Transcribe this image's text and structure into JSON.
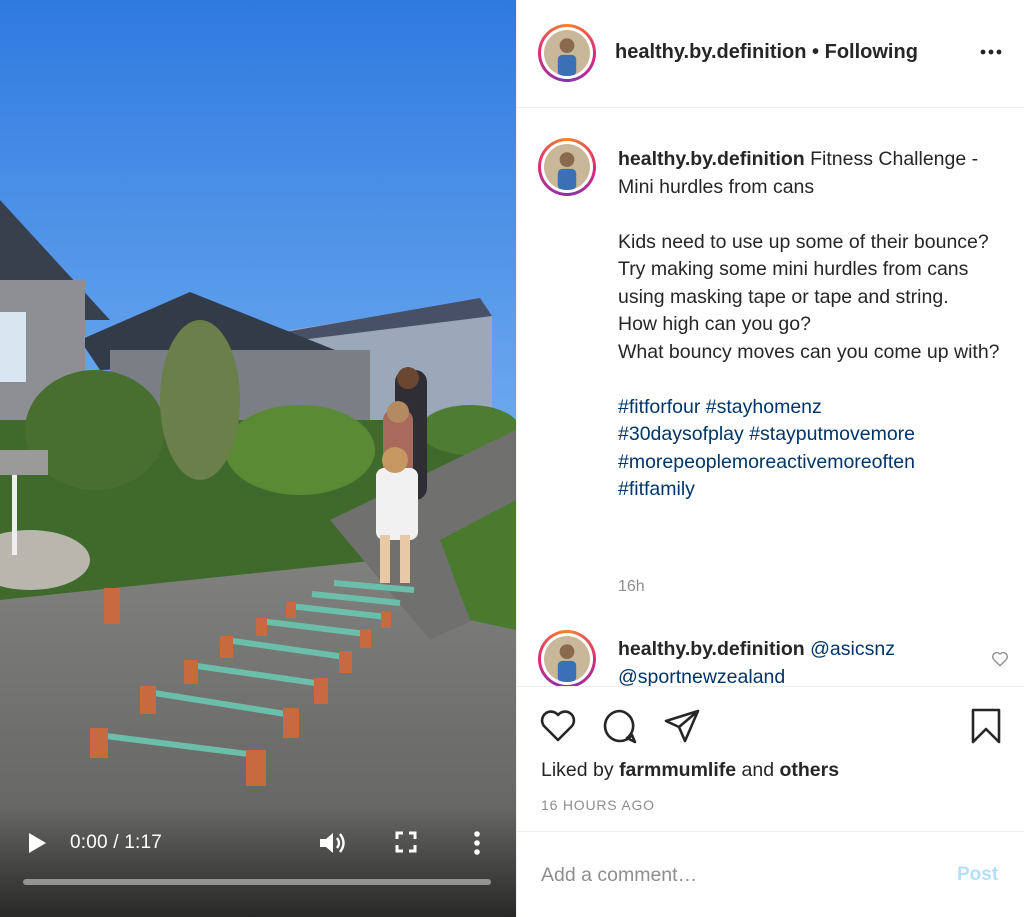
{
  "video": {
    "time_display": "0:00 / 1:17",
    "progress_fraction": 0.0,
    "icons": {
      "play": "play-icon",
      "volume": "volume-icon",
      "fullscreen": "fullscreen-icon",
      "more": "more-vertical-icon"
    }
  },
  "header": {
    "username": "healthy.by.definition",
    "separator": " • ",
    "follow_status": "Following",
    "more_icon": "more-horizontal-icon"
  },
  "caption": {
    "username": "healthy.by.definition",
    "title": " Fitness Challenge - Mini hurdles from cans",
    "body_lines": [
      "Kids need to use up some of their bounce? Try making some mini hurdles from cans using masking tape or tape and string.",
      "How high can you go?",
      "What bouncy moves can you come up with?"
    ],
    "hashtags": [
      "#fitforfour",
      "#stayhomenz",
      "#30daysofplay",
      "#stayputmovemore",
      "#morepeoplemoreactivemoreoften",
      "#fitfamily"
    ],
    "time": "16h"
  },
  "reply": {
    "username": "healthy.by.definition",
    "mention_1": "@asicsnz",
    "mention_2": "@sportnewzealand",
    "like_icon": "heart-outline-icon"
  },
  "actions": {
    "like_icon": "heart-outline-icon",
    "comment_icon": "comment-icon",
    "share_icon": "paper-plane-icon",
    "save_icon": "bookmark-icon",
    "liked_by_prefix": "Liked by ",
    "liked_by_user": "farmmumlife",
    "liked_by_and": " and ",
    "liked_by_others": "others",
    "posted_ago": "16 HOURS AGO"
  },
  "comment_box": {
    "placeholder": "Add a comment…",
    "post_label": "Post"
  },
  "colors": {
    "text": "#262626",
    "muted": "#8e8e8e",
    "hashtag": "#003569",
    "post_disabled": "#b2dffc",
    "sky": "#3d87e6"
  }
}
